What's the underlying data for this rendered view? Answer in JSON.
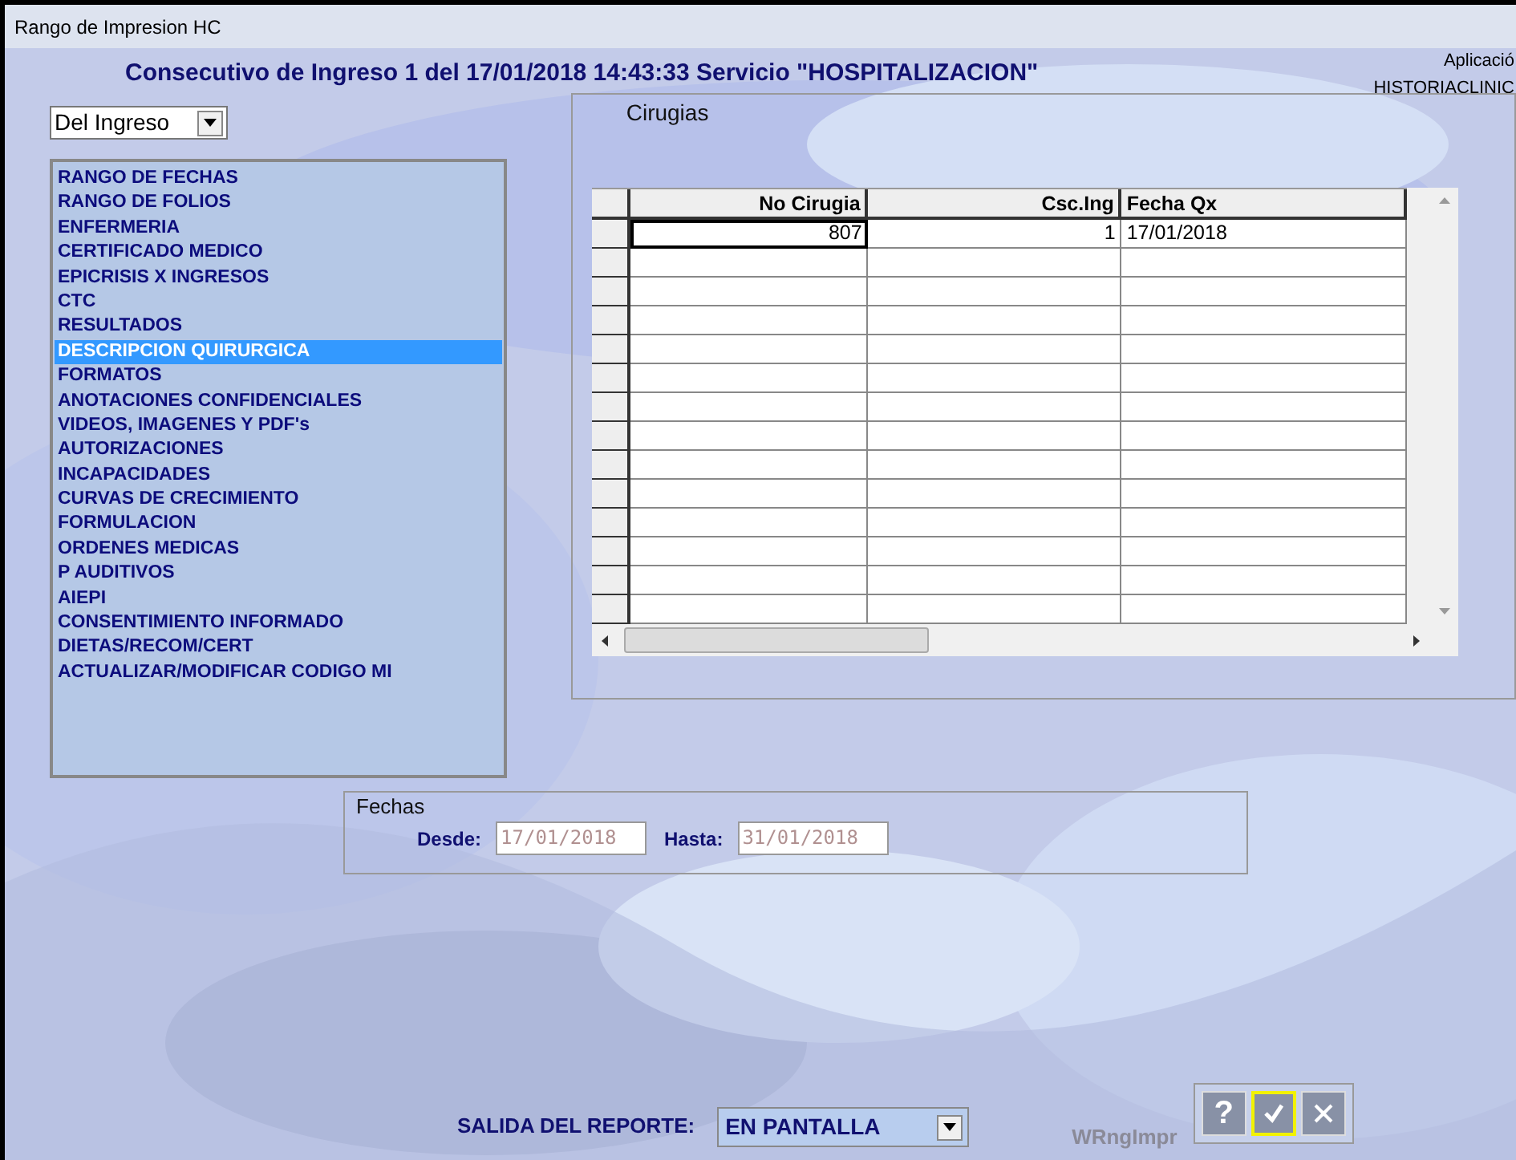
{
  "window": {
    "title": "Rango de Impresion HC"
  },
  "header": {
    "title": "Consecutivo de Ingreso 1 del 17/01/2018 14:43:33 Servicio \"HOSPITALIZACION\"",
    "app_label": "Aplicació",
    "app_name": "HISTORIACLINIC"
  },
  "scope_dropdown": {
    "value": "Del Ingreso"
  },
  "report_list": [
    {
      "label": "RANGO DE FECHAS",
      "selected": false
    },
    {
      "label": "RANGO DE FOLIOS",
      "selected": false
    },
    {
      "label": "ENFERMERIA",
      "selected": false
    },
    {
      "label": "CERTIFICADO MEDICO",
      "selected": false
    },
    {
      "label": "EPICRISIS X INGRESOS",
      "selected": false
    },
    {
      "label": "CTC",
      "selected": false
    },
    {
      "label": "RESULTADOS",
      "selected": false
    },
    {
      "label": "DESCRIPCION QUIRURGICA",
      "selected": true
    },
    {
      "label": "FORMATOS",
      "selected": false
    },
    {
      "label": "ANOTACIONES CONFIDENCIALES",
      "selected": false
    },
    {
      "label": "VIDEOS, IMAGENES Y PDF's",
      "selected": false
    },
    {
      "label": "AUTORIZACIONES",
      "selected": false
    },
    {
      "label": "INCAPACIDADES",
      "selected": false
    },
    {
      "label": "CURVAS DE CRECIMIENTO",
      "selected": false
    },
    {
      "label": "FORMULACION",
      "selected": false
    },
    {
      "label": "ORDENES MEDICAS",
      "selected": false
    },
    {
      "label": "P AUDITIVOS",
      "selected": false
    },
    {
      "label": "AIEPI",
      "selected": false
    },
    {
      "label": "CONSENTIMIENTO INFORMADO",
      "selected": false
    },
    {
      "label": "DIETAS/RECOM/CERT",
      "selected": false
    },
    {
      "label": "ACTUALIZAR/MODIFICAR CODIGO MI",
      "selected": false
    }
  ],
  "surgeries": {
    "title": "Cirugias",
    "table": {
      "columns": [
        "No Cirugia",
        "Csc.Ing",
        "Fecha Qx"
      ],
      "rows": [
        {
          "cells": [
            "807",
            "1",
            "17/01/2018"
          ]
        }
      ]
    }
  },
  "dates": {
    "title": "Fechas",
    "from_label": "Desde:",
    "from": "17/01/2018",
    "to_label": "Hasta:",
    "to": "31/01/2018"
  },
  "output": {
    "label": "SALIDA DEL REPORTE:",
    "value": "EN PANTALLA"
  },
  "form_code": "WRngImpr",
  "buttons": {
    "help": "?"
  }
}
